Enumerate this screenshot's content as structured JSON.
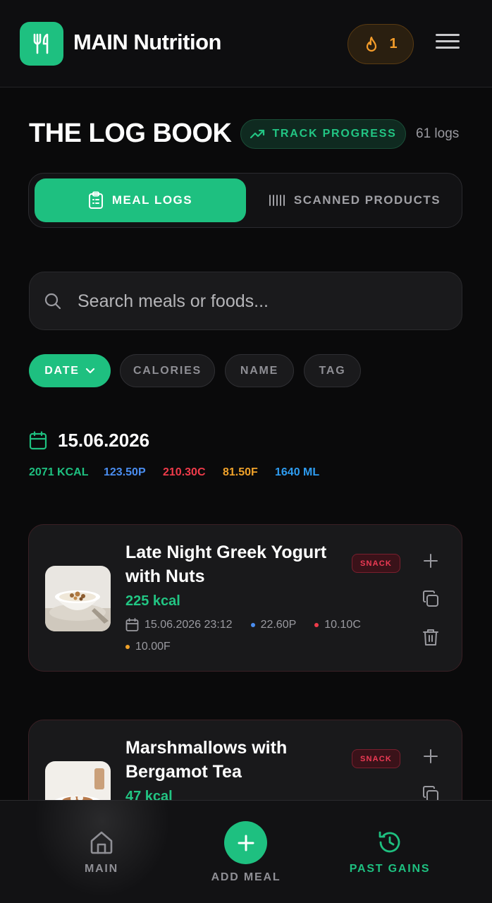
{
  "header": {
    "app_title": "MAIN Nutrition",
    "streak_count": "1",
    "icons": {
      "logo": "fork-knife-icon",
      "streak": "flame-icon",
      "menu": "hamburger-icon"
    }
  },
  "logbook": {
    "title": "THE LOG BOOK",
    "track_progress_label": "TRACK PROGRESS",
    "logs_count": "61 logs"
  },
  "tabs": [
    {
      "label": "MEAL LOGS",
      "icon": "clipboard-icon",
      "active": true
    },
    {
      "label": "SCANNED PRODUCTS",
      "icon": "barcode-icon",
      "active": false
    }
  ],
  "search": {
    "placeholder": "Search meals or foods...",
    "value": ""
  },
  "sort_chips": [
    {
      "label": "DATE",
      "active": true,
      "icon": "chevron-down-icon"
    },
    {
      "label": "CALORIES",
      "active": false
    },
    {
      "label": "NAME",
      "active": false
    },
    {
      "label": "TAG",
      "active": false
    }
  ],
  "day_group": {
    "date": "15.06.2026",
    "totals": {
      "kcal": "2071 KCAL",
      "protein": "123.50P",
      "carbs": "210.30C",
      "fat": "81.50F",
      "water": "1640 ML"
    }
  },
  "meals": [
    {
      "name": "Late Night Greek Yogurt with Nuts",
      "kcal": "225 kcal",
      "tag": "SNACK",
      "datetime": "15.06.2026 23:12",
      "protein": "22.60P",
      "carbs": "10.10C",
      "fat": "10.00F"
    },
    {
      "name": "Marshmallows with Bergamot Tea",
      "kcal": "47 kcal",
      "tag": "SNACK"
    }
  ],
  "bottom_nav": {
    "main_label": "MAIN",
    "add_label": "ADD MEAL",
    "past_label": "PAST GAINS"
  },
  "colors": {
    "accent": "#1ec080",
    "protein": "#4a8df0",
    "carbs": "#ef3b4a",
    "fat": "#f0a22a",
    "water": "#2e9cf0",
    "tag_red": "#ef3b55"
  }
}
